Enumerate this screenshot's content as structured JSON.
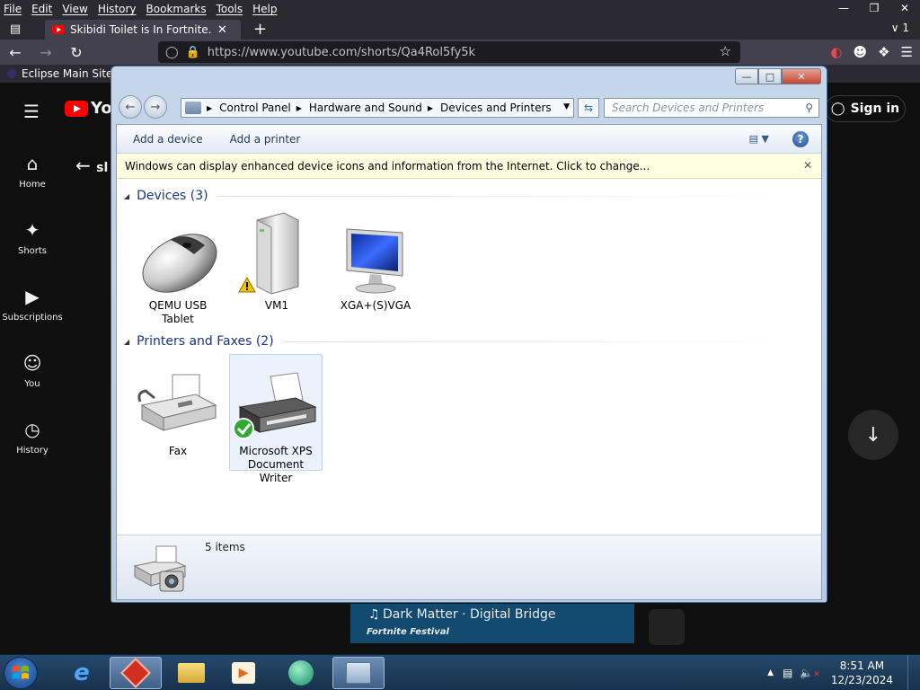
{
  "browser": {
    "menu": [
      "File",
      "Edit",
      "View",
      "History",
      "Bookmarks",
      "Tools",
      "Help"
    ],
    "tab_title": "Skibidi Toilet is In Fortnite..",
    "tab_count": "1",
    "url": "https://www.youtube.com/shorts/Qa4Rol5fy5k",
    "bookmark": "Eclipse Main Site"
  },
  "youtube": {
    "logo_text": "Yo",
    "back_text": "sl",
    "sign_in": "Sign in",
    "sidebar": [
      "Home",
      "Shorts",
      "Subscriptions",
      "You",
      "History"
    ],
    "music_song": "Dark Matter · Digital Bridge",
    "music_tag": "Fortnite Festival"
  },
  "explorer": {
    "breadcrumb": [
      "Control Panel",
      "Hardware and Sound",
      "Devices and Printers"
    ],
    "search_placeholder": "Search Devices and Printers",
    "toolbar": {
      "add_device": "Add a device",
      "add_printer": "Add a printer"
    },
    "infobar": "Windows can display enhanced device icons and information from the Internet. Click to change...",
    "groups": {
      "devices": "Devices (3)",
      "printers": "Printers and Faxes (2)"
    },
    "devices": [
      {
        "line1": "QEMU USB",
        "line2": "Tablet"
      },
      {
        "line1": "VM1",
        "line2": ""
      },
      {
        "line1": "XGA+(S)VGA",
        "line2": ""
      }
    ],
    "printers": [
      {
        "line1": "Fax",
        "line2": ""
      },
      {
        "line1": "Microsoft XPS",
        "line2": "Document Writer"
      }
    ],
    "details_count": "5 items"
  },
  "taskbar": {
    "time": "8:51 AM",
    "date": "12/23/2024"
  },
  "colors": {
    "firefox_dark": "#2b2a33",
    "youtube_bg": "#0f0f0f",
    "youtube_red": "#ff0000",
    "explorer_group_text": "#1e3287",
    "infobar_bg": "#ffffe1",
    "taskbar": "#1f3d5e"
  }
}
